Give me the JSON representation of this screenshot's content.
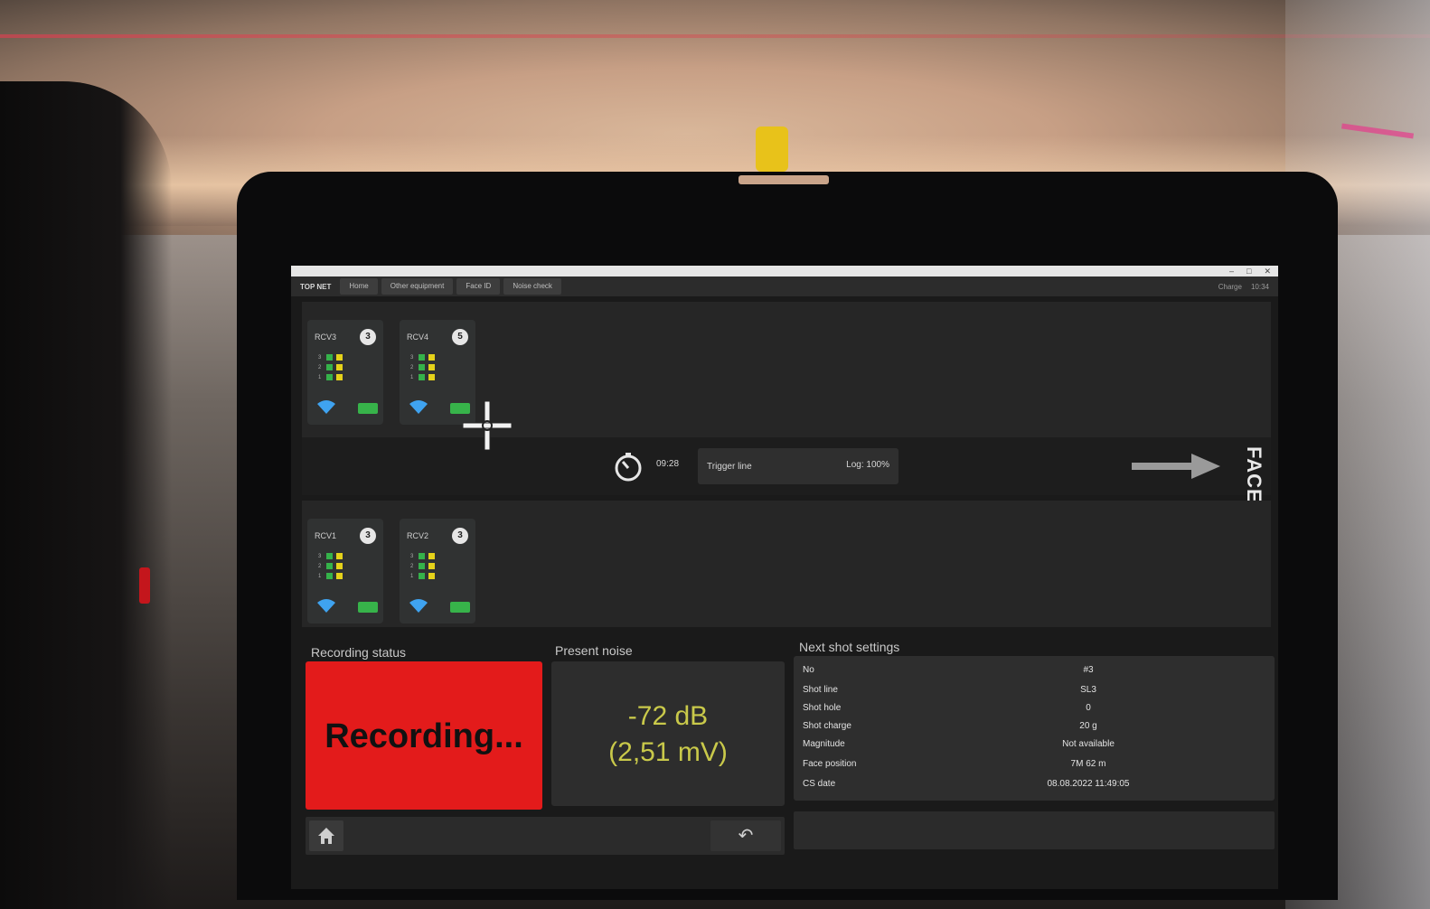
{
  "window": {
    "title": "",
    "controls": [
      "–",
      "□",
      "✕"
    ]
  },
  "tabbar": {
    "brand": "TOP NET",
    "tabs": [
      "Home",
      "Other equipment",
      "Face ID",
      "Noise check"
    ],
    "status": [
      "Charge",
      "10:34"
    ]
  },
  "receivers": {
    "top": [
      {
        "name": "RCV3",
        "badge": "3",
        "rows": [
          "3",
          "2",
          "1"
        ]
      },
      {
        "name": "RCV4",
        "badge": "5",
        "rows": [
          "3",
          "2",
          "1"
        ]
      }
    ],
    "bottom": [
      {
        "name": "RCV1",
        "badge": "3",
        "rows": [
          "3",
          "2",
          "1"
        ]
      },
      {
        "name": "RCV2",
        "badge": "3",
        "rows": [
          "3",
          "2",
          "1"
        ]
      }
    ]
  },
  "trigger": {
    "timer": "09:28",
    "trigger_label": "Trigger line",
    "log_label": "Log: 100%"
  },
  "face_label": "FACE",
  "recording_status": {
    "title": "Recording status",
    "text": "Recording...",
    "color": "#e31b1b"
  },
  "present_noise": {
    "title": "Present noise",
    "db": "-72 dB",
    "mv": "(2,51 mV)",
    "color": "#c9c94a"
  },
  "next_shot": {
    "title": "Next shot settings",
    "rows": [
      {
        "label": "No",
        "value": "#3"
      },
      {
        "label": "Shot line",
        "value": "SL3"
      },
      {
        "label": "Shot hole",
        "value": "0"
      },
      {
        "label": "Shot charge",
        "value": "20 g"
      },
      {
        "label": "Magnitude",
        "value": "Not available"
      },
      {
        "label": "Face position",
        "value": "7M 62 m"
      },
      {
        "label": "CS date",
        "value": "08.08.2022 11:49:05"
      }
    ]
  },
  "icons": {
    "home": "home-icon",
    "undo": "undo-icon",
    "timer": "stopwatch-icon",
    "arrow": "right-arrow-icon",
    "wifi": "wifi-icon",
    "battery": "battery-icon",
    "cursor": "crosshair-cursor-icon"
  }
}
